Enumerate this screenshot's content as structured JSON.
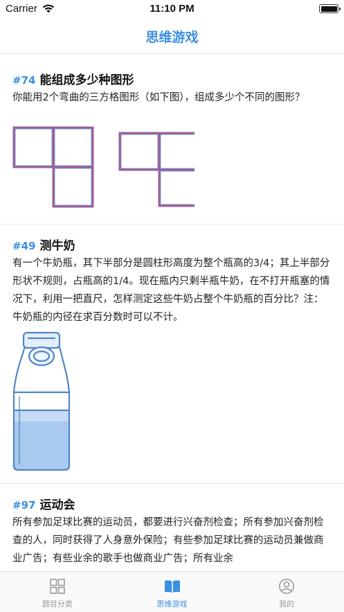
{
  "status_bar": {
    "carrier": "Carrier",
    "time": "11:10 PM"
  },
  "nav": {
    "title": "思维游戏"
  },
  "puzzles": [
    {
      "number": "#74",
      "title": "能组成多少种图形",
      "text": "你能用2个弯曲的三方格图形（如下图），组成多少个不同的图形？"
    },
    {
      "number": "#49",
      "title": "测牛奶",
      "text": "有一个牛奶瓶，其下半部分是圆柱形高度为整个瓶高的3/4；其上半部分形状不规则，占瓶高的1/4。现在瓶内只剩半瓶牛奶，在不打开瓶塞的情况下，利用一把直尺，怎样测定这些牛奶占整个牛奶瓶的百分比？注：牛奶瓶的内径在求百分数时可以不计。"
    },
    {
      "number": "#97",
      "title": "运动会",
      "text": "所有参加足球比赛的运动员，都要进行兴奋剂检查；所有参加兴奋剂检查的人，同时获得了人身意外保险；有些参加足球比赛的运动员兼做商业广告；有些业余的歌手也做商业广告；所有业余"
    }
  ],
  "tabs": [
    {
      "label": "题目分类",
      "icon": "grid-icon",
      "active": false
    },
    {
      "label": "思维游戏",
      "icon": "book-icon",
      "active": true
    },
    {
      "label": "我的",
      "icon": "user-icon",
      "active": false
    }
  ],
  "colors": {
    "accent": "#3a8fe0",
    "inactive": "#999999"
  }
}
